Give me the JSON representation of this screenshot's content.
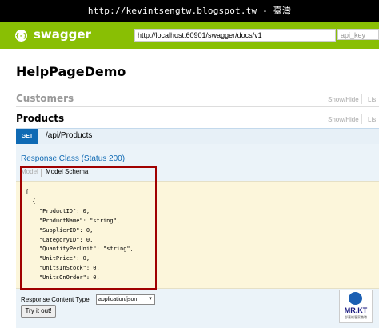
{
  "watermark": "http://kevintsengtw.blogspot.tw - 臺灣",
  "header": {
    "logo_text": "swagger",
    "logo_glyph": "{-}",
    "url_value": "http://localhost:60901/swagger/docs/v1",
    "api_key_placeholder": "api_key",
    "brand_color": "#89bf04"
  },
  "page_title": "HelpPageDemo",
  "resources": [
    {
      "name": "Customers",
      "show_hide": "Show/Hide",
      "list_ops": "Lis"
    },
    {
      "name": "Products",
      "show_hide": "Show/Hide",
      "list_ops": "Lis"
    }
  ],
  "operation": {
    "method": "GET",
    "path": "/api/Products",
    "method_color": "#0f6ab4",
    "response_class": "Response Class (Status 200)",
    "tab_model": "Model",
    "tab_schema": "Model Schema",
    "schema_lines": [
      "[",
      "  {",
      "    \"ProductID\": 0,",
      "    \"ProductName\": \"string\",",
      "    \"SupplierID\": 0,",
      "    \"CategoryID\": 0,",
      "    \"QuantityPerUnit\": \"string\",",
      "    \"UnitPrice\": 0,",
      "    \"UnitsInStock\": 0,",
      "    \"UnitsOnOrder\": 0,"
    ],
    "response_content_type_label": "Response Content Type",
    "response_content_type_value": "application/json",
    "try_button": "Try it out!"
  },
  "badge": {
    "text": "MR.KT",
    "subtext": "部落格客家兼職"
  }
}
